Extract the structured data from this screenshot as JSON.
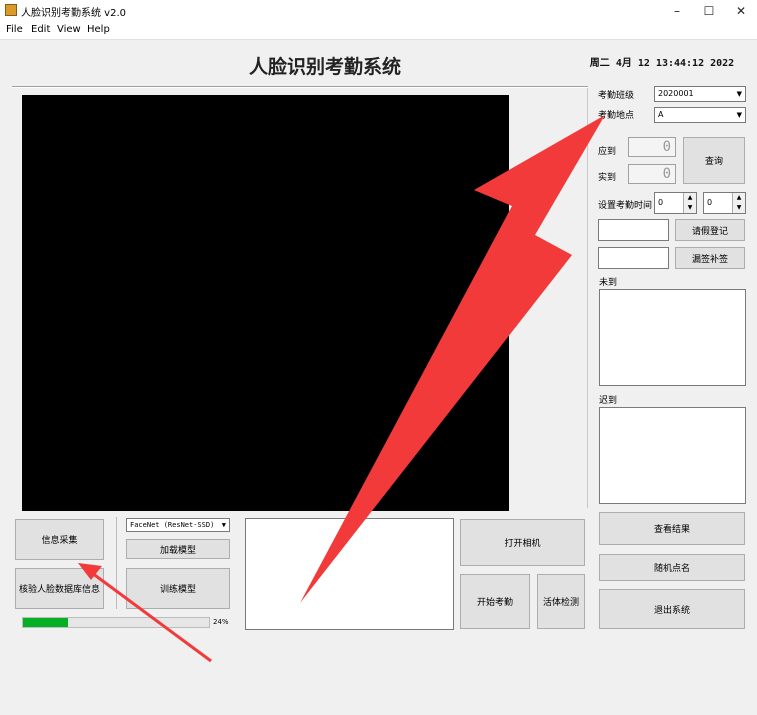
{
  "window": {
    "title": "人脸识别考勤系统 v2.0",
    "minimize": "–",
    "maximize": "☐",
    "close": "✕"
  },
  "menu": [
    "File",
    "Edit",
    "View",
    "Help"
  ],
  "app_title": "人脸识别考勤系统",
  "datetime": "周二 4月 12 13:44:12 2022",
  "right_panel": {
    "class_label": "考勤班级",
    "class_value": "2020001",
    "location_label": "考勤地点",
    "location_value": "A",
    "should_label": "应到",
    "should_value": "0",
    "actual_label": "实到",
    "actual_value": "0",
    "query_button": "查询",
    "set_time_label": "设置考勤时间",
    "hour_value": "0",
    "minute_value": "0",
    "leave_button": "请假登记",
    "makeup_button": "漏签补签",
    "absent_label": "未到",
    "late_label": "迟到",
    "view_results_button": "查看结果",
    "random_call_button": "随机点名",
    "exit_button": "退出系统"
  },
  "bottom": {
    "collect_button": "信息采集",
    "verify_button": "核验人脸数据库信息",
    "model_select": "FaceNet (ResNet-SSD)",
    "load_model_button": "加载模型",
    "train_model_button": "训练模型",
    "open_camera_button": "打开相机",
    "start_attendance_button": "开始考勤",
    "liveness_button": "活体检测",
    "progress_value": 0.24,
    "progress_text": "24%"
  },
  "colors": {
    "accent_green": "#06b025",
    "arrow_red": "#f23a3a"
  },
  "icons": {
    "dropdown": "▼",
    "spin_up": "▲",
    "spin_down": "▼"
  }
}
